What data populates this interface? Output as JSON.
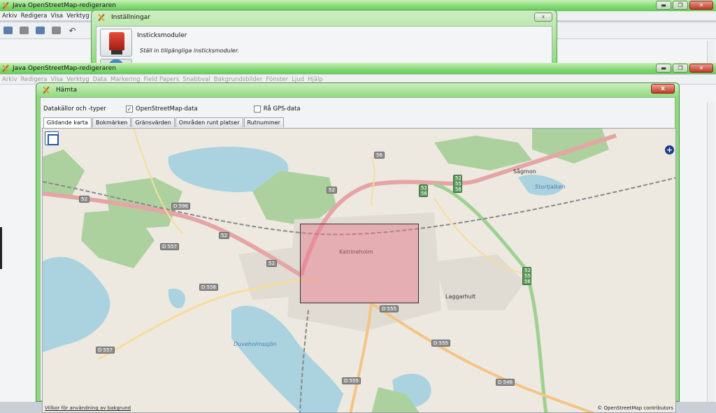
{
  "back_window": {
    "title": "Java OpenStreetMap-redigeraren",
    "menu": [
      "Arkiv",
      "Redigera",
      "Visa",
      "Verktyg"
    ]
  },
  "front_window": {
    "title": "Java OpenStreetMap-redigeraren",
    "menu": [
      "Arkiv",
      "Redigera",
      "Visa",
      "Verktyg",
      "Data",
      "Markering",
      "Field Papers",
      "Snabbval",
      "Bakgrundsbilder",
      "Fönster",
      "Ljud",
      "Hjälp"
    ]
  },
  "settings_dialog": {
    "title": "Inställningar",
    "close_label": "☓",
    "heading": "Insticksmoduler",
    "description": "Ställ in tillgängliga insticksmoduler."
  },
  "download_dialog": {
    "title": "Hämta",
    "close_label": "x",
    "sources_label": "Datakällor och -typer",
    "osm_data": {
      "label": "OpenStreetMap-data",
      "checked": true,
      "mark": "✓"
    },
    "gps_data": {
      "label": "Rå GPS-data",
      "checked": false,
      "mark": ""
    },
    "tabs": [
      "Glidande karta",
      "Bokmärken",
      "Gränsvärden",
      "Områden runt platser",
      "Rutnummer"
    ],
    "active_tab": "Glidande karta",
    "map": {
      "terms_link": "Villkor för användning av bakgrund",
      "attribution": "© OpenStreetMap contributors",
      "places": [
        "Katrineholm",
        "Sågmon",
        "Laggarhult"
      ],
      "water_labels": [
        "Stortjalken",
        "Duveholmssjön"
      ],
      "road_shields": [
        "52",
        "52",
        "52",
        "52",
        "56",
        "D 596",
        "D 557",
        "D 558",
        "D 557",
        "D 555",
        "D 555",
        "D 555",
        "D 546"
      ],
      "stacked_shields": [
        [
          "52",
          "55",
          "56"
        ],
        [
          "52",
          "56"
        ],
        [
          "52",
          "55",
          "56"
        ]
      ]
    }
  },
  "window_controls": {
    "minimize": "▬",
    "maximize": "❐",
    "close": "✕"
  }
}
